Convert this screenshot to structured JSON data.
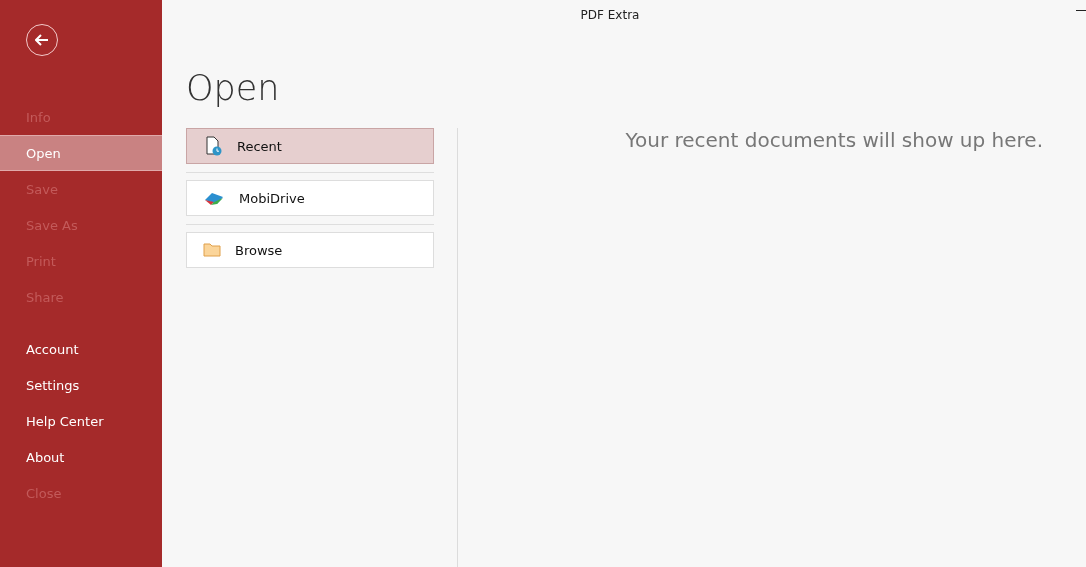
{
  "window": {
    "title": "PDF Extra"
  },
  "sidebar": {
    "groups": [
      {
        "items": [
          {
            "label": "Info",
            "disabled": true,
            "selected": false
          },
          {
            "label": "Open",
            "disabled": false,
            "selected": true
          },
          {
            "label": "Save",
            "disabled": true,
            "selected": false
          },
          {
            "label": "Save As",
            "disabled": true,
            "selected": false
          },
          {
            "label": "Print",
            "disabled": true,
            "selected": false
          },
          {
            "label": "Share",
            "disabled": true,
            "selected": false
          }
        ]
      },
      {
        "items": [
          {
            "label": "Account",
            "disabled": false,
            "selected": false
          },
          {
            "label": "Settings",
            "disabled": false,
            "selected": false
          },
          {
            "label": "Help Center",
            "disabled": false,
            "selected": false
          },
          {
            "label": "About",
            "disabled": false,
            "selected": false
          },
          {
            "label": "Close",
            "disabled": true,
            "selected": false
          }
        ]
      }
    ]
  },
  "page": {
    "heading": "Open",
    "locations": [
      {
        "label": "Recent",
        "kind": "recent",
        "selected": true
      },
      {
        "label": "MobiDrive",
        "kind": "cloud",
        "selected": false
      },
      {
        "label": "Browse",
        "kind": "folder",
        "selected": false
      }
    ],
    "empty_message": "Your recent documents will show up here."
  }
}
